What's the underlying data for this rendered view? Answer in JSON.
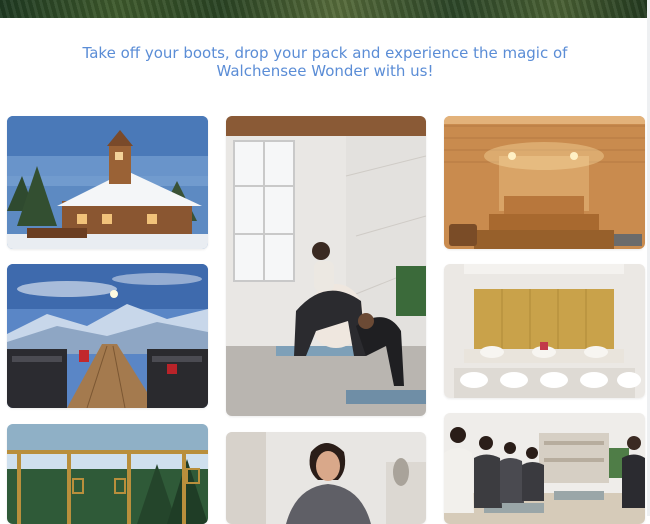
{
  "headline": {
    "text": "Take off your boots, drop your pack and experience the magic of Walchensee Wonder with us!",
    "color": "#5b8dd6"
  },
  "gallery": {
    "photos": [
      {
        "id": "winter-lodge"
      },
      {
        "id": "yoga-stretch"
      },
      {
        "id": "sauna"
      },
      {
        "id": "mountain-terrace"
      },
      {
        "id": "spa-lounge"
      },
      {
        "id": "glass-pavilion"
      },
      {
        "id": "meditation-woman"
      },
      {
        "id": "group-meditation"
      }
    ]
  }
}
